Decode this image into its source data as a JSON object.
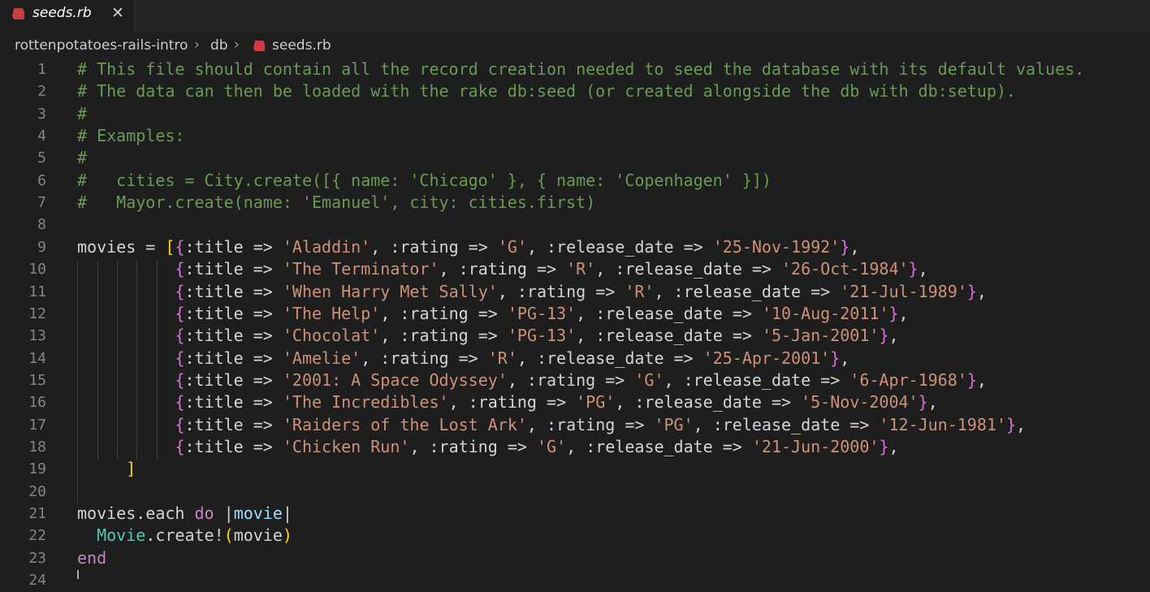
{
  "tab": {
    "filename": "seeds.rb",
    "close_glyph": "✕"
  },
  "breadcrumb": {
    "project": "rottenpotatoes-rails-intro",
    "folder": "db",
    "file": "seeds.rb"
  },
  "icons": {
    "tab_icon": "ruby-icon",
    "breadcrumb_file_icon": "ruby-icon",
    "separator": "chevron-right-icon"
  },
  "colors": {
    "ruby_icon": "#cc3e44",
    "comment": "#6a9955",
    "string": "#ce9178",
    "keyword": "#c586c0",
    "class": "#4ec9b0"
  },
  "editor": {
    "lines": [
      {
        "n": "1",
        "tokens": [
          [
            "c",
            "# This file should contain all the record creation needed to seed the database with its default values."
          ]
        ]
      },
      {
        "n": "2",
        "tokens": [
          [
            "c",
            "# The data can then be loaded with the rake db:seed (or created alongside the db with db:setup)."
          ]
        ]
      },
      {
        "n": "3",
        "tokens": [
          [
            "c",
            "#"
          ]
        ]
      },
      {
        "n": "4",
        "tokens": [
          [
            "c",
            "# Examples:"
          ]
        ]
      },
      {
        "n": "5",
        "tokens": [
          [
            "c",
            "#"
          ]
        ]
      },
      {
        "n": "6",
        "tokens": [
          [
            "c",
            "#   cities = City.create([{ name: 'Chicago' }, { name: 'Copenhagen' }])"
          ]
        ]
      },
      {
        "n": "7",
        "tokens": [
          [
            "c",
            "#   Mayor.create(name: 'Emanuel', city: cities.first)"
          ]
        ]
      },
      {
        "n": "8",
        "tokens": []
      },
      {
        "n": "9",
        "tokens": [
          [
            "p",
            "movies = "
          ],
          [
            "y",
            "["
          ],
          [
            "m",
            "{"
          ],
          [
            "p",
            ":title => "
          ],
          [
            "s",
            "'Aladdin'"
          ],
          [
            "p",
            ", :rating => "
          ],
          [
            "s",
            "'G'"
          ],
          [
            "p",
            ", :release_date => "
          ],
          [
            "s",
            "'25-Nov-1992'"
          ],
          [
            "m",
            "}"
          ],
          [
            "p",
            ","
          ]
        ]
      },
      {
        "n": "10",
        "tokens": [
          [
            "p",
            "          "
          ],
          [
            "m",
            "{"
          ],
          [
            "p",
            ":title => "
          ],
          [
            "s",
            "'The Terminator'"
          ],
          [
            "p",
            ", :rating => "
          ],
          [
            "s",
            "'R'"
          ],
          [
            "p",
            ", :release_date => "
          ],
          [
            "s",
            "'26-Oct-1984'"
          ],
          [
            "m",
            "}"
          ],
          [
            "p",
            ","
          ]
        ]
      },
      {
        "n": "11",
        "tokens": [
          [
            "p",
            "          "
          ],
          [
            "m",
            "{"
          ],
          [
            "p",
            ":title => "
          ],
          [
            "s",
            "'When Harry Met Sally'"
          ],
          [
            "p",
            ", :rating => "
          ],
          [
            "s",
            "'R'"
          ],
          [
            "p",
            ", :release_date => "
          ],
          [
            "s",
            "'21-Jul-1989'"
          ],
          [
            "m",
            "}"
          ],
          [
            "p",
            ","
          ]
        ]
      },
      {
        "n": "12",
        "tokens": [
          [
            "p",
            "          "
          ],
          [
            "m",
            "{"
          ],
          [
            "p",
            ":title => "
          ],
          [
            "s",
            "'The Help'"
          ],
          [
            "p",
            ", :rating => "
          ],
          [
            "s",
            "'PG-13'"
          ],
          [
            "p",
            ", :release_date => "
          ],
          [
            "s",
            "'10-Aug-2011'"
          ],
          [
            "m",
            "}"
          ],
          [
            "p",
            ","
          ]
        ]
      },
      {
        "n": "13",
        "tokens": [
          [
            "p",
            "          "
          ],
          [
            "m",
            "{"
          ],
          [
            "p",
            ":title => "
          ],
          [
            "s",
            "'Chocolat'"
          ],
          [
            "p",
            ", :rating => "
          ],
          [
            "s",
            "'PG-13'"
          ],
          [
            "p",
            ", :release_date => "
          ],
          [
            "s",
            "'5-Jan-2001'"
          ],
          [
            "m",
            "}"
          ],
          [
            "p",
            ","
          ]
        ]
      },
      {
        "n": "14",
        "tokens": [
          [
            "p",
            "          "
          ],
          [
            "m",
            "{"
          ],
          [
            "p",
            ":title => "
          ],
          [
            "s",
            "'Amelie'"
          ],
          [
            "p",
            ", :rating => "
          ],
          [
            "s",
            "'R'"
          ],
          [
            "p",
            ", :release_date => "
          ],
          [
            "s",
            "'25-Apr-2001'"
          ],
          [
            "m",
            "}"
          ],
          [
            "p",
            ","
          ]
        ]
      },
      {
        "n": "15",
        "tokens": [
          [
            "p",
            "          "
          ],
          [
            "m",
            "{"
          ],
          [
            "p",
            ":title => "
          ],
          [
            "s",
            "'2001: A Space Odyssey'"
          ],
          [
            "p",
            ", :rating => "
          ],
          [
            "s",
            "'G'"
          ],
          [
            "p",
            ", :release_date => "
          ],
          [
            "s",
            "'6-Apr-1968'"
          ],
          [
            "m",
            "}"
          ],
          [
            "p",
            ","
          ]
        ]
      },
      {
        "n": "16",
        "tokens": [
          [
            "p",
            "          "
          ],
          [
            "m",
            "{"
          ],
          [
            "p",
            ":title => "
          ],
          [
            "s",
            "'The Incredibles'"
          ],
          [
            "p",
            ", :rating => "
          ],
          [
            "s",
            "'PG'"
          ],
          [
            "p",
            ", :release_date => "
          ],
          [
            "s",
            "'5-Nov-2004'"
          ],
          [
            "m",
            "}"
          ],
          [
            "p",
            ","
          ]
        ]
      },
      {
        "n": "17",
        "tokens": [
          [
            "p",
            "          "
          ],
          [
            "m",
            "{"
          ],
          [
            "p",
            ":title => "
          ],
          [
            "s",
            "'Raiders of the Lost Ark'"
          ],
          [
            "p",
            ", :rating => "
          ],
          [
            "s",
            "'PG'"
          ],
          [
            "p",
            ", :release_date => "
          ],
          [
            "s",
            "'12-Jun-1981'"
          ],
          [
            "m",
            "}"
          ],
          [
            "p",
            ","
          ]
        ]
      },
      {
        "n": "18",
        "tokens": [
          [
            "p",
            "          "
          ],
          [
            "m",
            "{"
          ],
          [
            "p",
            ":title => "
          ],
          [
            "s",
            "'Chicken Run'"
          ],
          [
            "p",
            ", :rating => "
          ],
          [
            "s",
            "'G'"
          ],
          [
            "p",
            ", :release_date => "
          ],
          [
            "s",
            "'21-Jun-2000'"
          ],
          [
            "m",
            "}"
          ],
          [
            "p",
            ","
          ]
        ]
      },
      {
        "n": "19",
        "tokens": [
          [
            "p",
            "     "
          ],
          [
            "y",
            "]"
          ]
        ]
      },
      {
        "n": "20",
        "tokens": []
      },
      {
        "n": "21",
        "tokens": [
          [
            "p",
            "movies.each "
          ],
          [
            "k",
            "do"
          ],
          [
            "p",
            " |"
          ],
          [
            "v",
            "movie"
          ],
          [
            "p",
            "|"
          ]
        ]
      },
      {
        "n": "22",
        "tokens": [
          [
            "p",
            "  "
          ],
          [
            "t",
            "Movie"
          ],
          [
            "p",
            ".create!"
          ],
          [
            "y",
            "("
          ],
          [
            "p",
            "movie"
          ],
          [
            "y",
            ")"
          ]
        ]
      },
      {
        "n": "23",
        "tokens": [
          [
            "k",
            "end"
          ]
        ]
      },
      {
        "n": "24",
        "tokens": []
      }
    ]
  }
}
